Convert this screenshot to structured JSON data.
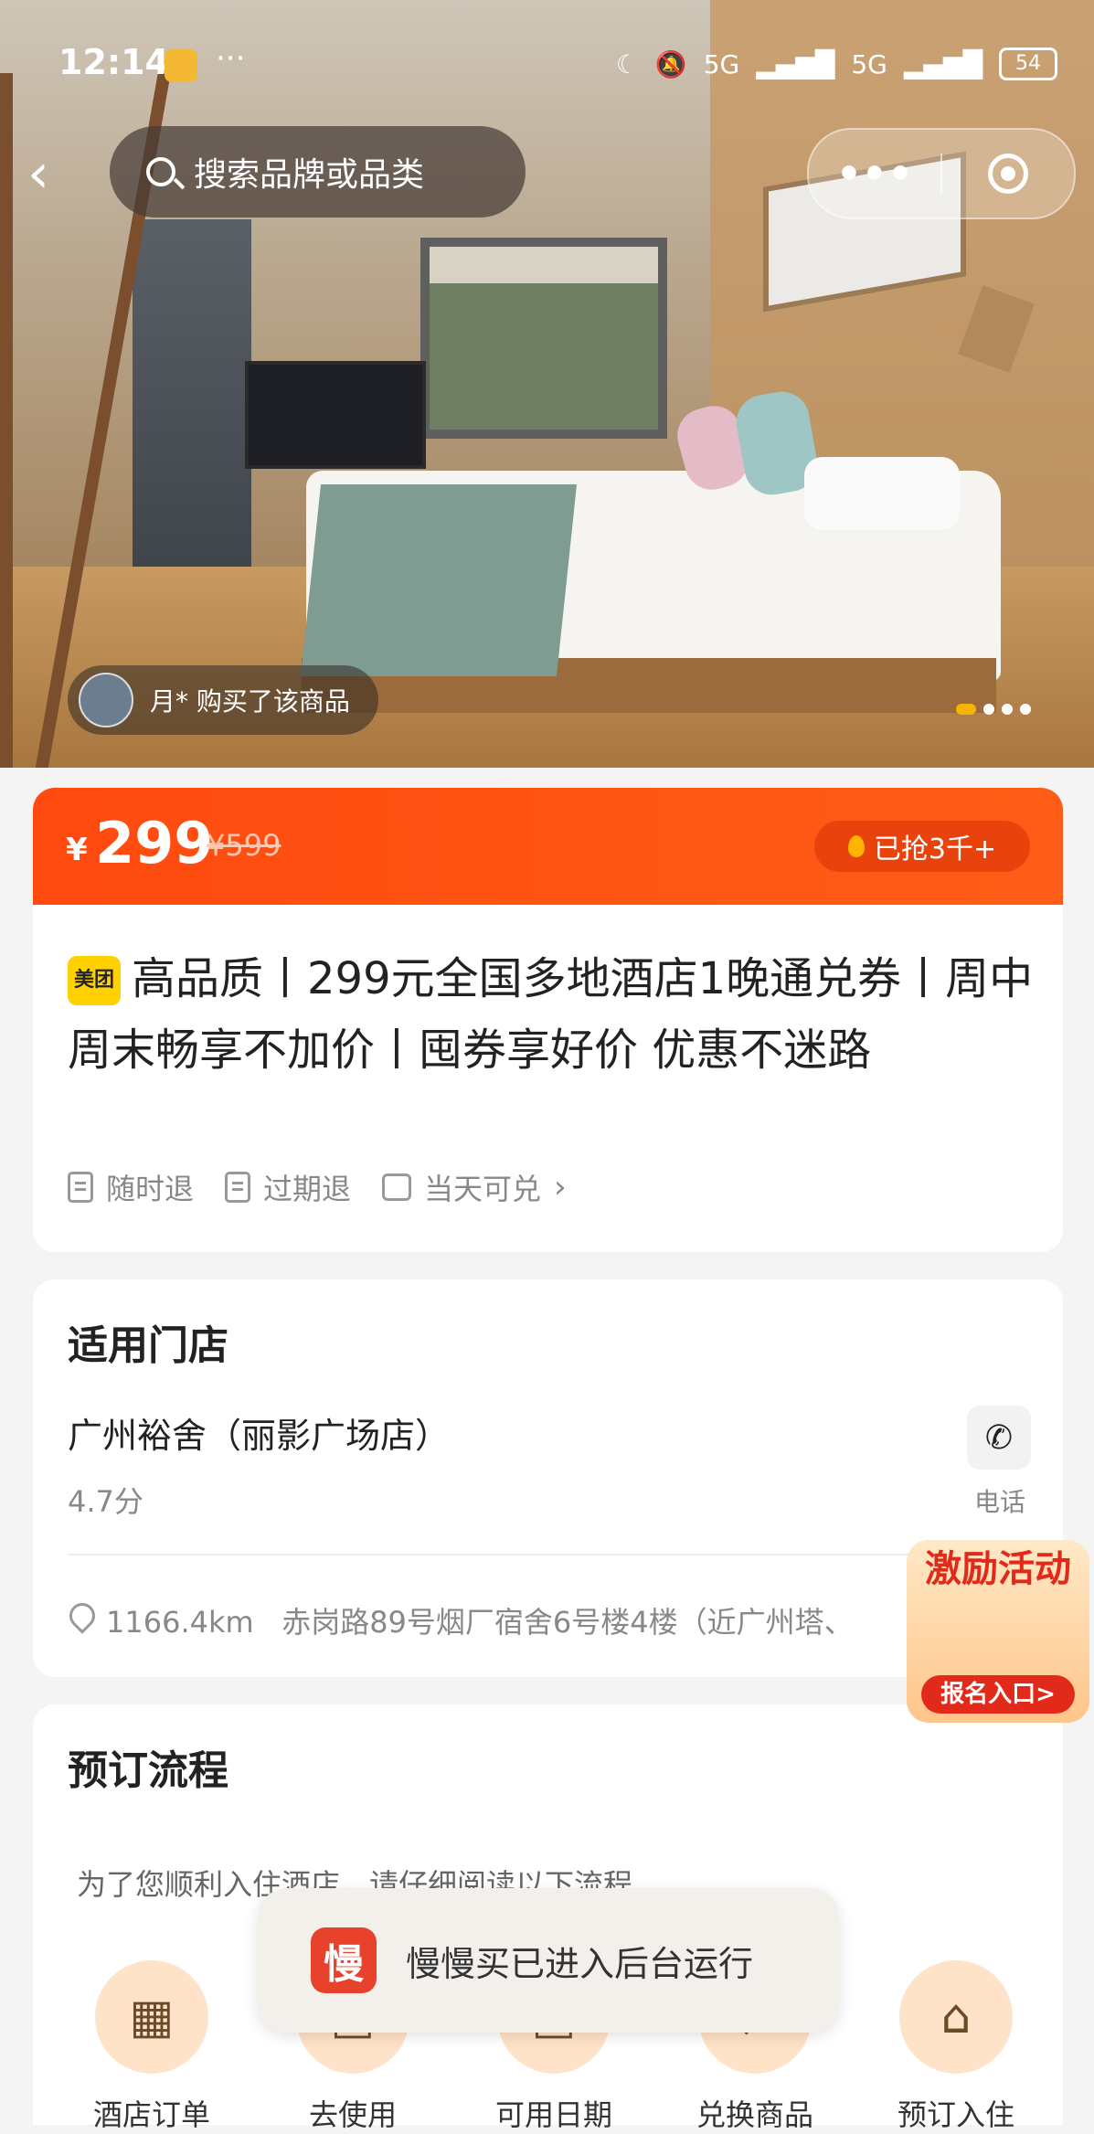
{
  "status": {
    "time": "12:14",
    "more": "···",
    "signal1": "5G",
    "signal2": "5G",
    "battery": "54"
  },
  "header": {
    "back": "‹",
    "search_placeholder": "搜索品牌或品类",
    "more_label": "•••"
  },
  "hero": {
    "buyer_text": "月* 购买了该商品"
  },
  "price": {
    "currency": "¥",
    "now": "299",
    "original": "¥599",
    "sold": "已抢3千+"
  },
  "product": {
    "badge": "美团",
    "title": "高品质丨299元全国多地酒店1晚通兑券丨周中周末畅享不加价丨囤券享好价 优惠不迷路",
    "tags": [
      {
        "label": "随时退",
        "icon": "doc-icon"
      },
      {
        "label": "过期退",
        "icon": "doc-icon"
      },
      {
        "label": "当天可兑",
        "icon": "calendar-check-icon"
      }
    ]
  },
  "store": {
    "section_title": "适用门店",
    "name": "广州裕舍（丽影广场店）",
    "score": "4.7分",
    "phone_label": "电话",
    "distance": "1166.4km",
    "address": "赤岗路89号烟厂宿舍6号楼4楼（近广州塔、"
  },
  "promo": {
    "title": "激励活动",
    "button": "报名入口>"
  },
  "flow": {
    "section_title": "预订流程",
    "intro": "为了您顺利入住酒店，请仔细阅读以下流程",
    "steps": [
      {
        "label": "酒店订单",
        "icon": "building-icon"
      },
      {
        "label": "去使用",
        "icon": "ticket-icon"
      },
      {
        "label": "可用日期",
        "icon": "calendar-icon"
      },
      {
        "label": "兑换商品",
        "icon": "exchange-icon"
      },
      {
        "label": "预订入住",
        "icon": "house-clock-icon"
      }
    ]
  },
  "toast": {
    "logo_char": "慢",
    "text": "慢慢买已进入后台运行"
  }
}
